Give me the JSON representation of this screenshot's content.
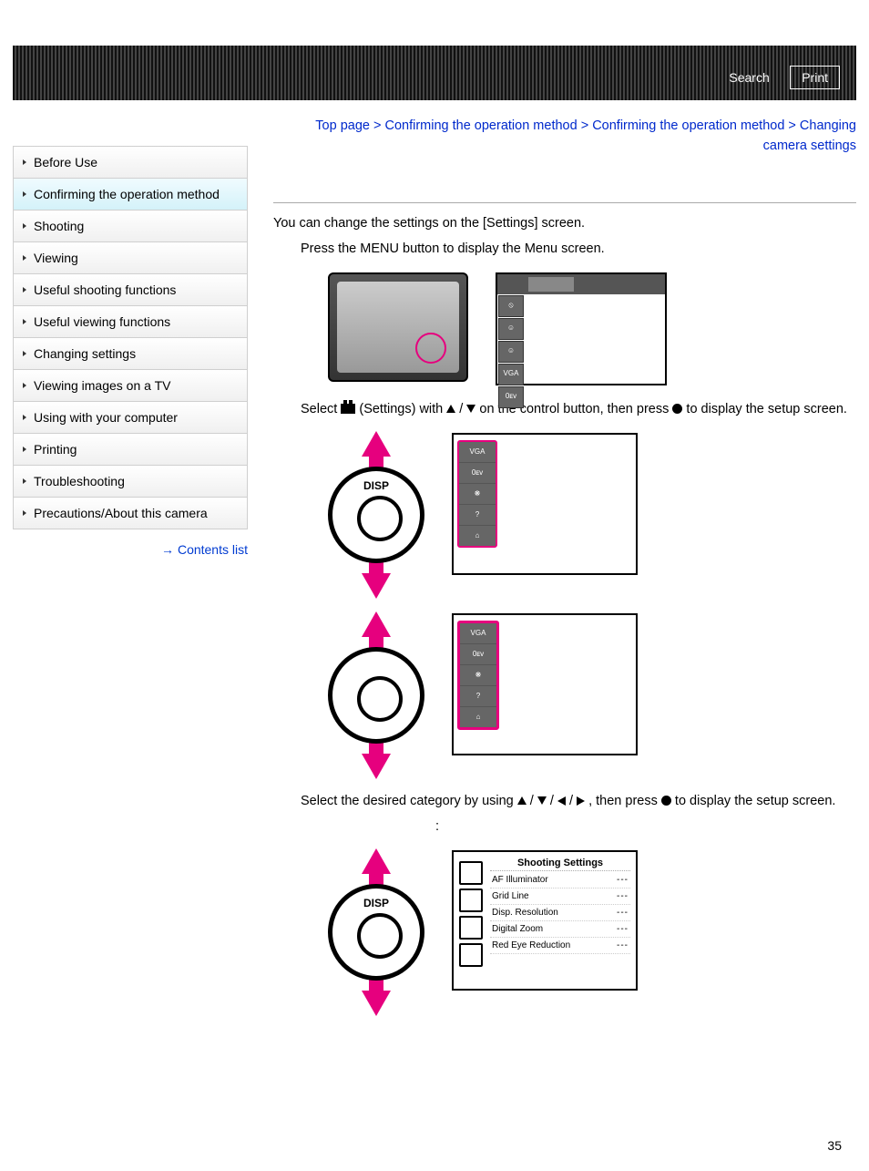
{
  "header": {
    "search": "Search",
    "print": "Print"
  },
  "breadcrumbs": {
    "items": [
      "Top page",
      "Confirming the operation method",
      "Confirming the operation method",
      "Changing camera settings"
    ],
    "sep": " > "
  },
  "sidebar": {
    "items": [
      {
        "label": "Before Use",
        "active": false
      },
      {
        "label": "Confirming the operation method",
        "active": true
      },
      {
        "label": "Shooting",
        "active": false
      },
      {
        "label": "Viewing",
        "active": false
      },
      {
        "label": "Useful shooting functions",
        "active": false
      },
      {
        "label": "Useful viewing functions",
        "active": false
      },
      {
        "label": "Changing settings",
        "active": false
      },
      {
        "label": "Viewing images on a TV",
        "active": false
      },
      {
        "label": "Using with your computer",
        "active": false
      },
      {
        "label": "Printing",
        "active": false
      },
      {
        "label": "Troubleshooting",
        "active": false
      },
      {
        "label": "Precautions/About this camera",
        "active": false
      }
    ],
    "contents_link": "Contents list"
  },
  "body": {
    "intro": "You can change the settings on the [Settings] screen.",
    "step1": "Press the MENU button to display the Menu screen.",
    "step2_a": "Select ",
    "step2_b": " (Settings) with ",
    "step2_c": " / ",
    "step2_d": " on the control button, then press ",
    "step2_e": " to display the setup screen.",
    "step3_a": "Select the desired category by using ",
    "step3_b": " / ",
    "step3_c": " , then press ",
    "step3_d": " to display the setup screen.",
    "step3_colon": ":"
  },
  "menu_badges": [
    "⦸",
    "☺",
    "☺",
    "VGA",
    "0ᴇᴠ"
  ],
  "stack_badges": [
    "VGA",
    "0ᴇᴠ",
    "❋",
    "?",
    "⌂"
  ],
  "control_label": "DISP",
  "settings_panel": {
    "title": "Shooting Settings",
    "rows": [
      {
        "label": "AF Illuminator",
        "val": "---"
      },
      {
        "label": "Grid Line",
        "val": "---"
      },
      {
        "label": "Disp. Resolution",
        "val": "---"
      },
      {
        "label": "Digital Zoom",
        "val": "---"
      },
      {
        "label": "Red Eye Reduction",
        "val": "---"
      }
    ]
  },
  "page_number": "35"
}
